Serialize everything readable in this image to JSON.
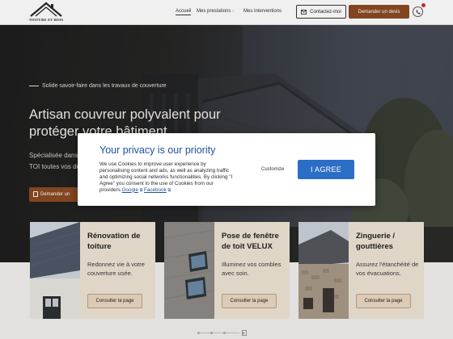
{
  "header": {
    "logo_text": "TOITURE ET BOIS",
    "nav": [
      {
        "label": "Accueil",
        "active": true
      },
      {
        "label": "Mes prestations",
        "has_dropdown": true
      },
      {
        "label": "Mes interventions",
        "has_dropdown": false
      }
    ],
    "contact_label": "Contactez-moi",
    "devis_label": "Demander un devis",
    "phone_icon": "phone-icon"
  },
  "hero": {
    "tagline": "Solide savoir-faire dans les travaux de couverture",
    "title": "Artisan couvreur polyvalent pour protéger votre bâtiment",
    "text": "Spécialisée dans l'entreprise TOI toutes vos dem",
    "cta_label": "Demander un"
  },
  "cards": [
    {
      "title": "Rénovation de toiture",
      "desc": "Redonnez vie à votre couverture usée.",
      "btn": "Consulter la page"
    },
    {
      "title": "Pose de fenêtre de toit VELUX",
      "desc": "Illuminez vos combles avec soin.",
      "btn": "Consulter la page"
    },
    {
      "title": "Zinguerie / gouttières",
      "desc": "Assurez l'étanchéité de vos évacuations.",
      "btn": "Consulter la page"
    }
  ],
  "pagination": {
    "current_label": "II"
  },
  "privacy": {
    "title": "Your privacy is our priority",
    "body": "We use Cookies to improve user experience by personalising content and ads, as well as analyzing traffic and optimizing social networks functionalities. By clicking \"I Agree\" you consent to the use of Cookies from our providers",
    "link_google": "Google",
    "link_facebook": "Facebook",
    "customize_label": "Customize",
    "agree_label": "I AGREE"
  },
  "colors": {
    "brand_brown": "#8b4a22",
    "modal_blue": "#2b6ec6",
    "title_blue": "#1f4fa0",
    "card_bg": "#efe4d5"
  }
}
